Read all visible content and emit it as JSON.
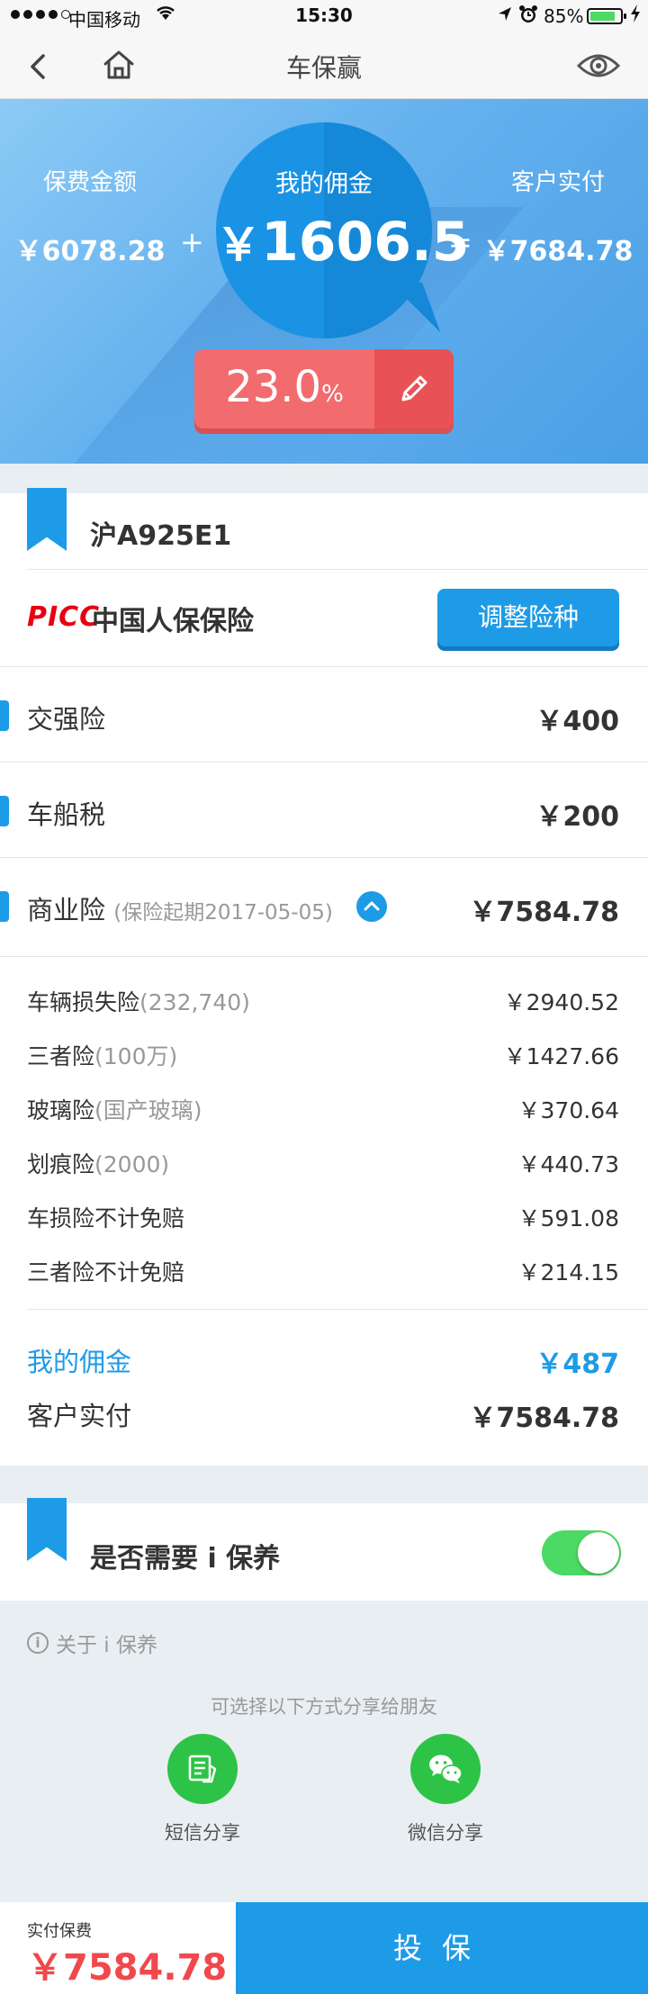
{
  "status_bar": {
    "carrier": "中国移动",
    "time": "15:30",
    "battery_percent": "85%",
    "battery_level": 0.85
  },
  "nav": {
    "title": "车保赢"
  },
  "summary": {
    "premium_label": "保费金额",
    "premium_amount": "￥6078.28",
    "commission_label": "我的佣金",
    "commission_currency": "￥",
    "commission_amount": "1606.5",
    "paid_label": "客户实付",
    "paid_amount": "￥7684.78",
    "plus": "+",
    "equals": "=",
    "rate_value": "23.0",
    "rate_unit": "%"
  },
  "policy": {
    "plate": "沪A925E1",
    "insurer_logo": "PICC",
    "insurer_name": "中国人保保险",
    "adjust_button": "调整险种",
    "rows": [
      {
        "name": "交强险",
        "sub": "",
        "value": "￥400"
      },
      {
        "name": "车船税",
        "sub": "",
        "value": "￥200"
      },
      {
        "name": "商业险",
        "sub": "(保险起期2017-05-05)",
        "value": "￥7584.78"
      }
    ],
    "details": [
      {
        "name": "车辆损失险",
        "sub": "(232,740)",
        "value": "￥2940.52"
      },
      {
        "name": "三者险",
        "sub": "(100万)",
        "value": "￥1427.66"
      },
      {
        "name": "玻璃险",
        "sub": "(国产玻璃)",
        "value": "￥370.64"
      },
      {
        "name": "划痕险",
        "sub": "(2000)",
        "value": "￥440.73"
      },
      {
        "name": "车损险不计免赔",
        "sub": "",
        "value": "￥591.08"
      },
      {
        "name": "三者险不计免赔",
        "sub": "",
        "value": "￥214.15"
      }
    ],
    "commission_label": "我的佣金",
    "commission_value": "￥487",
    "paid_label": "客户实付",
    "paid_value": "￥7584.78"
  },
  "maintenance": {
    "label": "是否需要 i 保养",
    "enabled": true,
    "about": "关于 i 保养"
  },
  "share": {
    "hint": "可选择以下方式分享给朋友",
    "sms_label": "短信分享",
    "wechat_label": "微信分享"
  },
  "bottom": {
    "pay_label": "实付保费",
    "pay_amount": "￥7584.78",
    "insure_button": "投保"
  },
  "colors": {
    "accent": "#1e9be6",
    "danger": "#f0484c",
    "switch_on": "#4cd964",
    "share_green": "#2dc346"
  }
}
